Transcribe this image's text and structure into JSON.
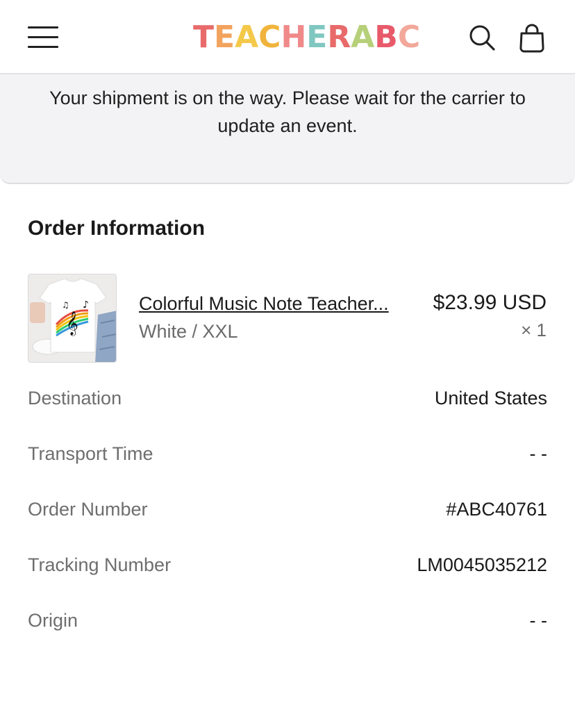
{
  "header": {
    "logo_letters": [
      {
        "char": "T",
        "color": "#e86a6a"
      },
      {
        "char": "E",
        "color": "#f2a35e"
      },
      {
        "char": "A",
        "color": "#f4c94a"
      },
      {
        "char": "C",
        "color": "#f0b43c"
      },
      {
        "char": "H",
        "color": "#f08a8a"
      },
      {
        "char": "E",
        "color": "#7fc7c0"
      },
      {
        "char": "R",
        "color": "#e86a6a"
      },
      {
        "char": "A",
        "color": "#b6d07a"
      },
      {
        "char": "B",
        "color": "#e85a6a"
      },
      {
        "char": "C",
        "color": "#f2a89a"
      }
    ],
    "icons": {
      "menu": "menu-icon",
      "search": "search-icon",
      "bag": "bag-icon"
    }
  },
  "notice": {
    "text": "Your shipment is on the way. Please wait for the carrier to update an event."
  },
  "order": {
    "title": "Order Information",
    "product": {
      "name": "Colorful Music Note Teacher...",
      "variant": "White / XXL",
      "price": "$23.99 USD",
      "quantity": "× 1"
    },
    "rows": [
      {
        "label": "Destination",
        "value": "United States"
      },
      {
        "label": "Transport Time",
        "value": "- -"
      },
      {
        "label": "Order Number",
        "value": "#ABC40761"
      },
      {
        "label": "Tracking Number",
        "value": "LM0045035212"
      },
      {
        "label": "Origin",
        "value": "- -"
      }
    ]
  }
}
